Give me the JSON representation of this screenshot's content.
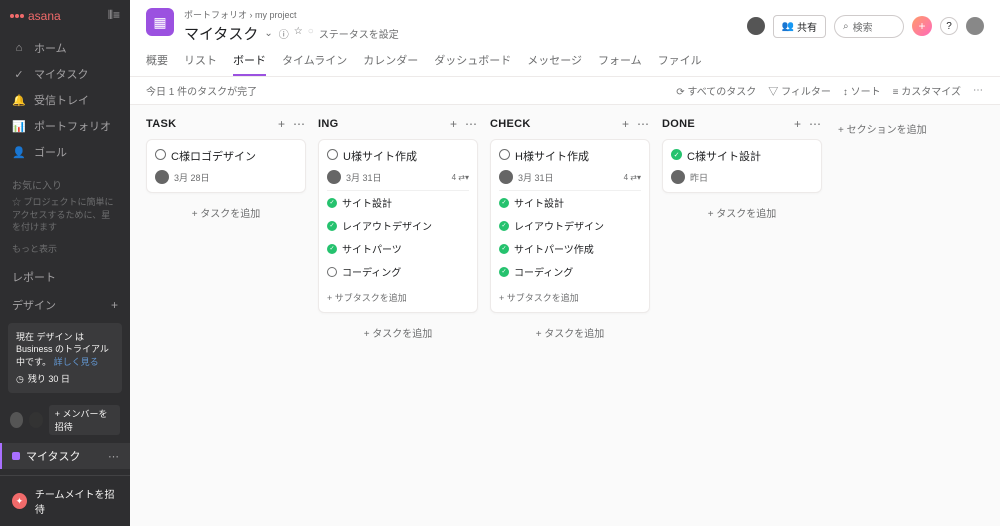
{
  "app": "asana",
  "sidebar": {
    "nav": [
      {
        "icon": "⌂",
        "label": "ホーム"
      },
      {
        "icon": "✓",
        "label": "マイタスク"
      },
      {
        "icon": "🔔",
        "label": "受信トレイ"
      },
      {
        "icon": "📊",
        "label": "ポートフォリオ"
      },
      {
        "icon": "👤",
        "label": "ゴール"
      }
    ],
    "favorites_label": "お気に入り",
    "favorites_hint": "☆ プロジェクトに簡単にアクセスするために、星を付けます",
    "more": "もっと表示",
    "reports_label": "レポート",
    "design_label": "デザイン",
    "trial_text": "現在 デザイン は Business のトライアル中です。",
    "trial_link": "詳しく見る",
    "trial_days": "残り 30 日",
    "invite_members": "+ メンバーを招待",
    "project_name": "マイタスク",
    "footer": "チームメイトを招待"
  },
  "header": {
    "breadcrumb_parent": "ポートフォリオ",
    "breadcrumb_child": "my project",
    "title": "マイタスク",
    "status": "ステータスを設定",
    "share": "共有",
    "search_placeholder": "検索",
    "tabs": [
      "概要",
      "リスト",
      "ボード",
      "タイムライン",
      "カレンダー",
      "ダッシュボード",
      "メッセージ",
      "フォーム",
      "ファイル"
    ],
    "active_tab": 2
  },
  "toolbar": {
    "status_text": "今日 1 件のタスクが完了",
    "all_tasks": "すべてのタスク",
    "filter": "フィルター",
    "sort": "ソート",
    "customize": "カスタマイズ"
  },
  "board": {
    "add_section": "+ セクションを追加",
    "add_task": "+ タスクを追加",
    "add_subtask": "+ サブタスクを追加",
    "columns": [
      {
        "title": "TASK",
        "cards": [
          {
            "done": false,
            "title": "C様ロゴデザイン",
            "date": "3月 28日",
            "subtasks": [],
            "badge": ""
          }
        ]
      },
      {
        "title": "ING",
        "cards": [
          {
            "done": false,
            "title": "U様サイト作成",
            "date": "3月 31日",
            "badge": "4 ⇄▾",
            "subtasks": [
              {
                "done": true,
                "label": "サイト設計"
              },
              {
                "done": true,
                "label": "レイアウトデザイン"
              },
              {
                "done": true,
                "label": "サイトパーツ"
              },
              {
                "done": false,
                "label": "コーディング"
              }
            ]
          }
        ]
      },
      {
        "title": "CHECK",
        "cards": [
          {
            "done": false,
            "title": "H様サイト作成",
            "date": "3月 31日",
            "badge": "4 ⇄▾",
            "subtasks": [
              {
                "done": true,
                "label": "サイト設計"
              },
              {
                "done": true,
                "label": "レイアウトデザイン"
              },
              {
                "done": true,
                "label": "サイトパーツ作成"
              },
              {
                "done": true,
                "label": "コーディング"
              }
            ]
          }
        ]
      },
      {
        "title": "DONE",
        "cards": [
          {
            "done": true,
            "title": "C様サイト設計",
            "date": "昨日",
            "subtasks": [],
            "badge": ""
          }
        ]
      }
    ]
  }
}
